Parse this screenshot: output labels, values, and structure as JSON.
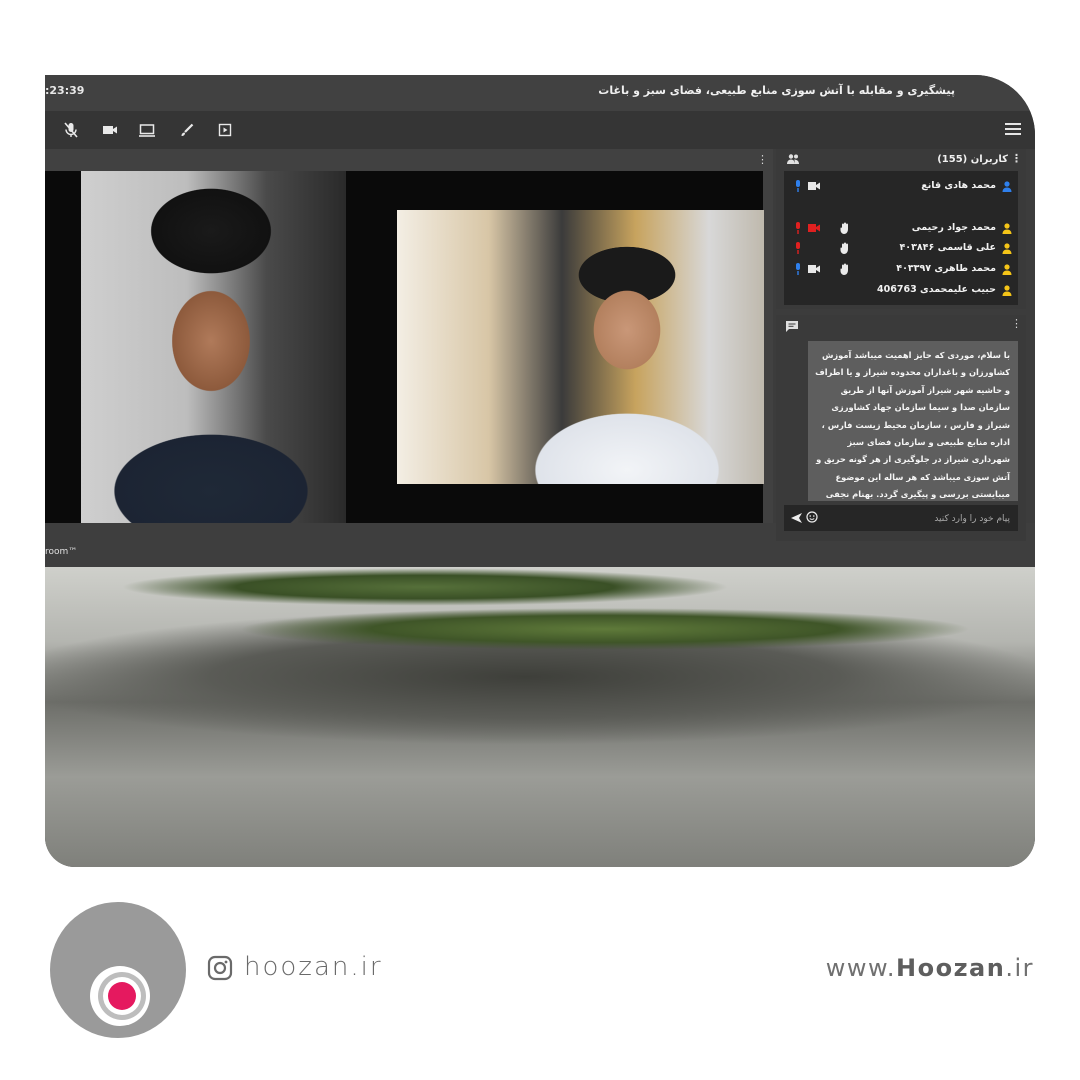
{
  "app": {
    "clock": ":23:39",
    "title": "پیشگیری و مقابله با آتش سوزی منابع طبیعی، فضای سبز و باغات",
    "branding": "room™"
  },
  "toolbar": {
    "buttons": [
      "mic-muted-icon",
      "camera-icon",
      "screen-share-icon",
      "whiteboard-pen-icon",
      "media-play-icon",
      "menu-icon"
    ]
  },
  "users": {
    "title": "کاربران (155)",
    "list": [
      {
        "name": "محمد هادی قانع",
        "mic": "on",
        "cam": true,
        "hand": false,
        "icon_color": "#2f80ed"
      },
      {
        "name": "محمد جواد رحیمی",
        "mic": "muted",
        "cam": true,
        "cam_color": "#e02020",
        "hand": true,
        "icon_color": "#f5c518"
      },
      {
        "name": "علی قاسمی ۴۰۳۸۴۶",
        "mic": "muted",
        "cam": false,
        "hand": true,
        "icon_color": "#f5c518"
      },
      {
        "name": "محمد طاهری ۴۰۳۳۹۷",
        "mic": "on",
        "cam": true,
        "hand": true,
        "icon_color": "#f5c518"
      },
      {
        "name": "حبیب علیمحمدی 406763",
        "mic": "none",
        "cam": false,
        "hand": false,
        "icon_color": "#f5c518"
      }
    ]
  },
  "chat": {
    "message": "با سلام، موردی که حایز اهمیت میباشد آموزش کشاورزان و باغداران محدوده شیراز و یا اطراف و حاشیه شهر شیراز آموزش آنها از طریق سازمان صدا و سیما سازمان جهاد کشاورزی شیراز و فارس ، سازمان محیط زیست فارس ، اداره منابع طبیعی و سازمان فضای سبز شهرداری شیراز در جلوگیری از هر گونه حریق و آتش سوزی میباشد که هر ساله این موضوع میبایستی بررسی و پیگیری گردد. بهنام نجفی نژادیان شیراز",
    "input_placeholder": "پیام خود را وارد کنید"
  },
  "footer": {
    "instagram_handle": "hoozan.ir",
    "website_prefix": "www.",
    "website_brand": "Hoozan",
    "website_suffix": ".ir"
  },
  "colors": {
    "accent_pink": "#e5195f",
    "logo_gray": "#9a9a9a",
    "mic_on_blue": "#2f80ed",
    "mic_muted_red": "#e02020"
  }
}
